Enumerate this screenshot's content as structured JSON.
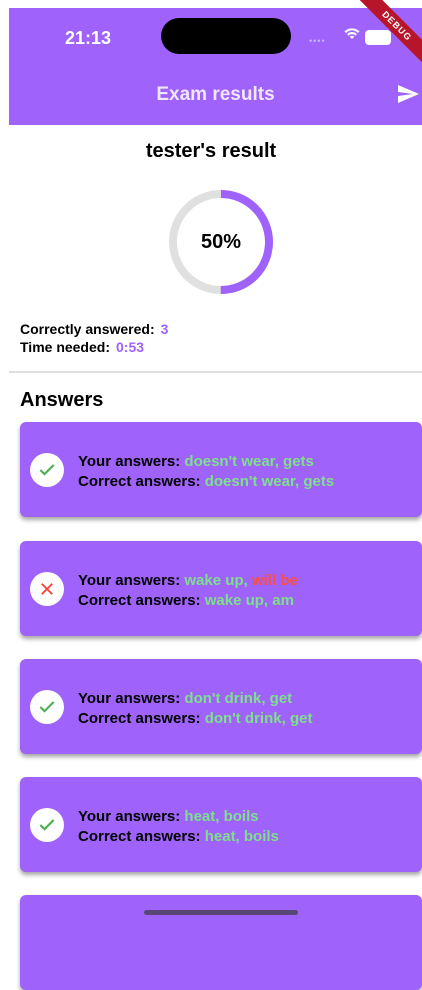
{
  "status_bar": {
    "time": "21:13",
    "debug_label": "DEBUG"
  },
  "app_bar": {
    "title": "Exam results",
    "action_icon": "send-icon"
  },
  "result": {
    "title": "tester's result",
    "percent_label": "50%",
    "progress_fraction": 0.5,
    "stats": [
      {
        "label": "Correctly answered:",
        "value": "3"
      },
      {
        "label": "Time needed:",
        "value": "0:53"
      }
    ]
  },
  "answers_heading": "Answers",
  "answer_labels": {
    "yours": "Your answers:",
    "correct": "Correct answers:"
  },
  "answers": [
    {
      "status": "correct",
      "your_answers": [
        {
          "text": "doesn't wear",
          "correct": true
        },
        {
          "text": "gets",
          "correct": true
        }
      ],
      "correct_answers": "doesn't wear, gets"
    },
    {
      "status": "wrong",
      "your_answers": [
        {
          "text": "wake up",
          "correct": true
        },
        {
          "text": "will be",
          "correct": false
        }
      ],
      "correct_answers": "wake up, am"
    },
    {
      "status": "correct",
      "your_answers": [
        {
          "text": "don't drink",
          "correct": true
        },
        {
          "text": "get",
          "correct": true
        }
      ],
      "correct_answers": "don't drink, get"
    },
    {
      "status": "correct",
      "your_answers": [
        {
          "text": "heat",
          "correct": true
        },
        {
          "text": "boils",
          "correct": true
        }
      ],
      "correct_answers": "heat, boils"
    },
    {
      "status": "correct",
      "your_answers": [],
      "correct_answers": ""
    }
  ],
  "colors": {
    "accent": "#9f62fb",
    "correct_text": "#7ee08a",
    "wrong_text": "#ff4d3d",
    "check_icon": "#4caf50",
    "cross_icon": "#f44336",
    "ring_track": "#e0e0e0"
  }
}
